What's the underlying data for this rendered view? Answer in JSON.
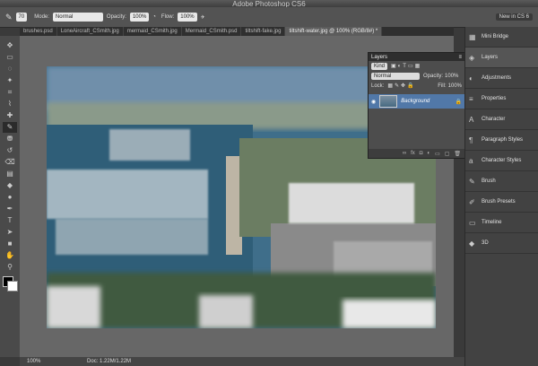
{
  "window": {
    "title": "Adobe Photoshop CS6",
    "new_label": "New in CS 6"
  },
  "options": {
    "mode_label": "Mode:",
    "mode_value": "Normal",
    "opacity_label": "Opacity:",
    "opacity_value": "100%",
    "flow_label": "Flow:",
    "flow_value": "100%",
    "brush_size": "70"
  },
  "tabs": [
    {
      "label": "brushes.psd"
    },
    {
      "label": "LoneAircraft_CSmith.jpg"
    },
    {
      "label": "mermaid_CSmith.jpg"
    },
    {
      "label": "Mermaid_CSmith.psd"
    },
    {
      "label": "tiltshift-fake.jpg"
    },
    {
      "label": "tiltshift-water.jpg @ 100% (RGB/8#) *"
    }
  ],
  "status": {
    "zoom": "100%",
    "doc_info": "Doc: 1.22M/1.22M"
  },
  "layers_panel": {
    "title": "Layers",
    "kind_label": "Kind",
    "blend_mode": "Normal",
    "opacity_label": "Opacity:",
    "opacity_value": "100%",
    "lock_label": "Lock:",
    "fill_label": "Fill:",
    "fill_value": "100%",
    "layer_name": "Background"
  },
  "dock": [
    {
      "label": "Mini Bridge",
      "icon": "mini-bridge-icon",
      "glyph": "▦"
    },
    {
      "label": "Layers",
      "icon": "layers-icon",
      "glyph": "◈"
    },
    {
      "label": "Adjustments",
      "icon": "adjustments-icon",
      "glyph": "◐"
    },
    {
      "label": "Properties",
      "icon": "properties-icon",
      "glyph": "≡"
    },
    {
      "label": "Character",
      "icon": "character-icon",
      "glyph": "A"
    },
    {
      "label": "Paragraph Styles",
      "icon": "paragraph-styles-icon",
      "glyph": "¶"
    },
    {
      "label": "Character Styles",
      "icon": "character-styles-icon",
      "glyph": "a"
    },
    {
      "label": "Brush",
      "icon": "brush-icon",
      "glyph": "✎"
    },
    {
      "label": "Brush Presets",
      "icon": "brush-presets-icon",
      "glyph": "✐"
    },
    {
      "label": "Timeline",
      "icon": "timeline-icon",
      "glyph": "▭"
    },
    {
      "label": "3D",
      "icon": "3d-icon",
      "glyph": "◆"
    }
  ],
  "tools": [
    {
      "name": "move-tool-icon",
      "glyph": "✥"
    },
    {
      "name": "marquee-tool-icon",
      "glyph": "▭"
    },
    {
      "name": "lasso-tool-icon",
      "glyph": "◌"
    },
    {
      "name": "quick-select-tool-icon",
      "glyph": "✦"
    },
    {
      "name": "crop-tool-icon",
      "glyph": "⌗"
    },
    {
      "name": "eyedropper-tool-icon",
      "glyph": "⌇"
    },
    {
      "name": "healing-tool-icon",
      "glyph": "✚"
    },
    {
      "name": "brush-tool-icon",
      "glyph": "✎"
    },
    {
      "name": "clone-stamp-tool-icon",
      "glyph": "⛃"
    },
    {
      "name": "history-brush-tool-icon",
      "glyph": "↺"
    },
    {
      "name": "eraser-tool-icon",
      "glyph": "⌫"
    },
    {
      "name": "gradient-tool-icon",
      "glyph": "▤"
    },
    {
      "name": "blur-tool-icon",
      "glyph": "◆"
    },
    {
      "name": "dodge-tool-icon",
      "glyph": "●"
    },
    {
      "name": "pen-tool-icon",
      "glyph": "✒"
    },
    {
      "name": "type-tool-icon",
      "glyph": "T"
    },
    {
      "name": "path-select-tool-icon",
      "glyph": "➤"
    },
    {
      "name": "shape-tool-icon",
      "glyph": "■"
    },
    {
      "name": "hand-tool-icon",
      "glyph": "✋"
    },
    {
      "name": "zoom-tool-icon",
      "glyph": "⚲"
    }
  ]
}
